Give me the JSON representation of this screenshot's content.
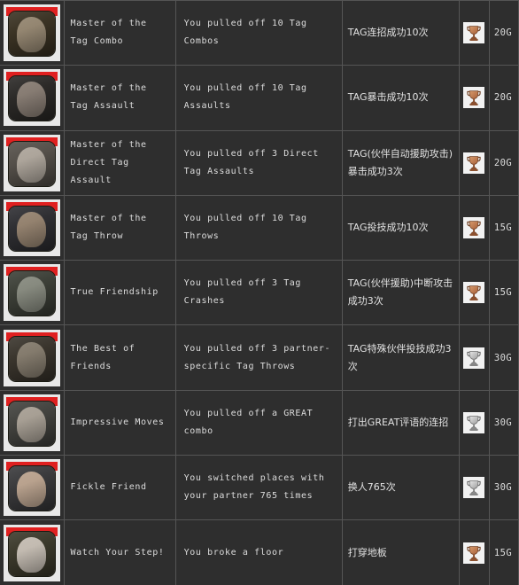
{
  "table": {
    "columns": [
      "icon",
      "name",
      "description",
      "description_cn",
      "trophy",
      "score"
    ],
    "rows": [
      {
        "name": "Master of the Tag Combo",
        "description": "You pulled off 10 Tag Combos",
        "description_cn": "TAG连招成功10次",
        "trophy": "bronze-trophy-icon",
        "score": "20G",
        "icon": "character-portrait-icon",
        "portrait_bg": "#3b3324",
        "portrait_face": "#9c8d78"
      },
      {
        "name": "Master of the Tag Assault",
        "description": "You pulled off 10 Tag Assaults",
        "description_cn": "TAG暴击成功10次",
        "trophy": "bronze-trophy-icon",
        "score": "20G",
        "icon": "character-portrait-icon",
        "portrait_bg": "#2c2a28",
        "portrait_face": "#8f837a"
      },
      {
        "name": "Master of the Direct Tag Assault",
        "description": "You pulled off 3 Direct Tag Assaults",
        "description_cn": "TAG(伙伴自动援助攻击)暴击成功3次",
        "trophy": "bronze-trophy-icon",
        "score": "20G",
        "icon": "character-portrait-icon",
        "portrait_bg": "#55504a",
        "portrait_face": "#b5ada2"
      },
      {
        "name": "Master of the Tag Throw",
        "description": "You pulled off 10 Tag Throws",
        "description_cn": "TAG投技成功10次",
        "trophy": "bronze-trophy-icon",
        "score": "15G",
        "icon": "character-portrait-icon",
        "portrait_bg": "#2f2f33",
        "portrait_face": "#9d8a74"
      },
      {
        "name": "True Friendship",
        "description": "You pulled off 3 Tag Crashes",
        "description_cn": "TAG(伙伴援助)中断攻击成功3次",
        "trophy": "bronze-trophy-icon",
        "score": "15G",
        "icon": "character-portrait-icon",
        "portrait_bg": "#3d4038",
        "portrait_face": "#8d9086"
      },
      {
        "name": "The Best of Friends",
        "description": "You pulled off 3 partner-specific Tag Throws",
        "description_cn": "TAG特殊伙伴投技成功3次",
        "trophy": "silver-trophy-icon",
        "score": "30G",
        "icon": "character-portrait-icon",
        "portrait_bg": "#3a352d",
        "portrait_face": "#8b8173"
      },
      {
        "name": "Impressive Moves",
        "description": "You pulled off a GREAT combo",
        "description_cn": "打出GREAT评语的连招",
        "trophy": "silver-trophy-icon",
        "score": "30G",
        "icon": "character-portrait-icon",
        "portrait_bg": "#43433f",
        "portrait_face": "#b0a79b"
      },
      {
        "name": "Fickle Friend",
        "description": "You switched places with your partner 765 times",
        "description_cn": "换人765次",
        "trophy": "silver-trophy-icon",
        "score": "30G",
        "icon": "character-portrait-icon",
        "portrait_bg": "#3a3a3c",
        "portrait_face": "#c4ab96"
      },
      {
        "name": "Watch Your Step!",
        "description": "You broke a floor",
        "description_cn": "打穿地板",
        "trophy": "bronze-trophy-icon",
        "score": "15G",
        "icon": "character-portrait-icon",
        "portrait_bg": "#3c3a2c",
        "portrait_face": "#cfc7bd"
      }
    ]
  },
  "colors": {
    "background": "#2e2e2e",
    "grid_line": "#555555",
    "text": "#dcdcdc",
    "icon_frame": "#e8e8e8",
    "icon_band": "#e02020",
    "trophy_bronze": "#b5764a",
    "trophy_silver": "#b9b9b9"
  }
}
